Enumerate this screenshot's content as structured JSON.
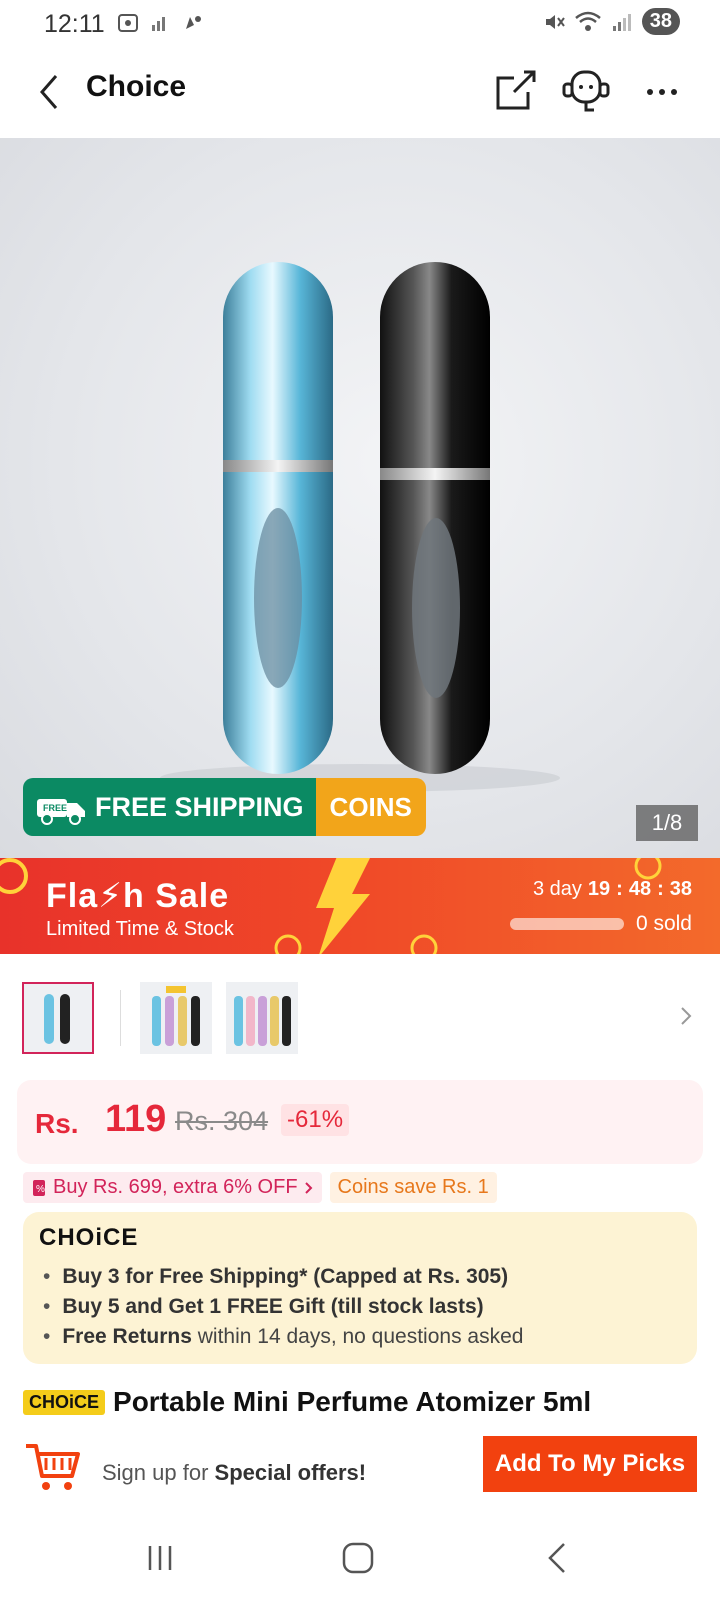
{
  "status_bar": {
    "time": "12:11",
    "battery": "38"
  },
  "header": {
    "title": "Choice",
    "back_icon": "chevron-left-icon",
    "share_icon": "share-icon",
    "support_icon": "customer-service-icon",
    "more_icon": "more-dots-icon"
  },
  "hero": {
    "free_label": "FREE",
    "free_shipping": "FREE SHIPPING",
    "coins": "COINS",
    "page_indicator": "1/8"
  },
  "flash_sale": {
    "title": "Fla⚡h Sale",
    "subtitle": "Limited Time & Stock",
    "days_label": "3 day",
    "hours": "19",
    "minutes": "48",
    "seconds": "38",
    "sold": "0 sold",
    "sold_fraction": 0
  },
  "thumbnails": [
    {
      "label": "blue-black"
    },
    {
      "label": "pack-4"
    },
    {
      "label": "pack-5"
    }
  ],
  "price": {
    "currency": "Rs.",
    "amount": "119",
    "original": "Rs. 304",
    "discount": "-61%"
  },
  "promos": {
    "coupon": "Buy Rs. 699, extra 6% OFF",
    "coins": "Coins save Rs. 1"
  },
  "choice_box": {
    "logo": "CHOiCE",
    "line1": "Buy 3 for  Free Shipping* (Capped at Rs. 305)",
    "line2": "Buy 5 and Get 1 FREE Gift (till stock lasts)",
    "line3_bold": "Free Returns",
    "line3_rest": " within 14 days, no questions asked"
  },
  "product": {
    "badge": "CHOiCE",
    "name": "Portable Mini Perfume Atomizer 5ml"
  },
  "bottom_bar": {
    "signup_prefix": "Sign up for ",
    "signup_bold": "Special offers!",
    "add_button": "Add To My Picks"
  },
  "colors": {
    "accent_red": "#e5283a",
    "flash_orange": "#f04a28",
    "add_button": "#f2410f",
    "shipping_green": "#0b8a63",
    "coins_orange": "#f2a51a"
  }
}
